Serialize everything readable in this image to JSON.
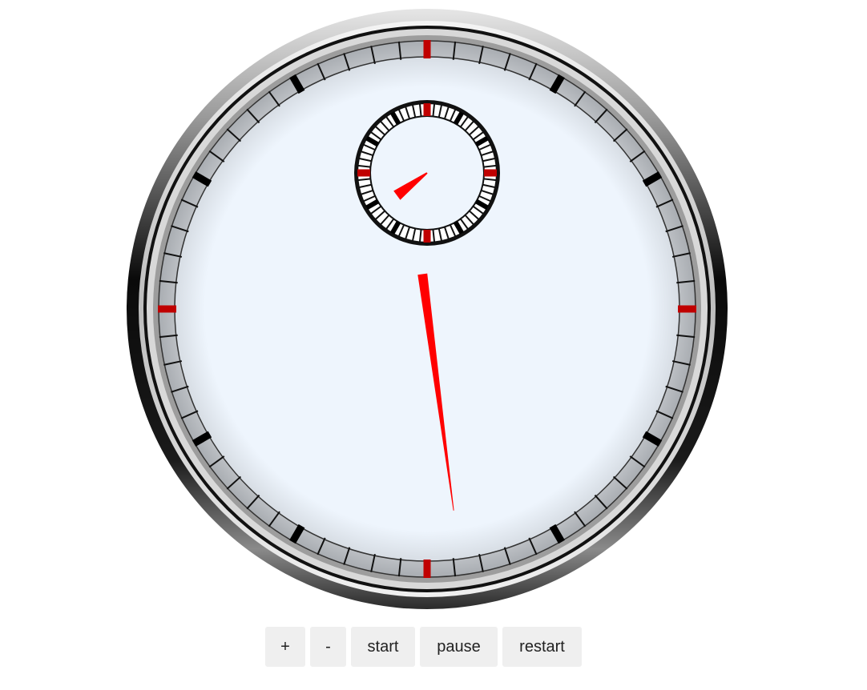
{
  "stopwatch": {
    "elapsed_seconds": 88.75,
    "colors": {
      "face": "#eef5fd",
      "hand": "#ff0000",
      "tick_major": "#c00000",
      "tick_quarter": "#000000",
      "bezel_dark": "#111111",
      "bezel_light": "#dcdcdc"
    }
  },
  "controls": {
    "plus_label": "+",
    "minus_label": "-",
    "start_label": "start",
    "pause_label": "pause",
    "restart_label": "restart"
  }
}
